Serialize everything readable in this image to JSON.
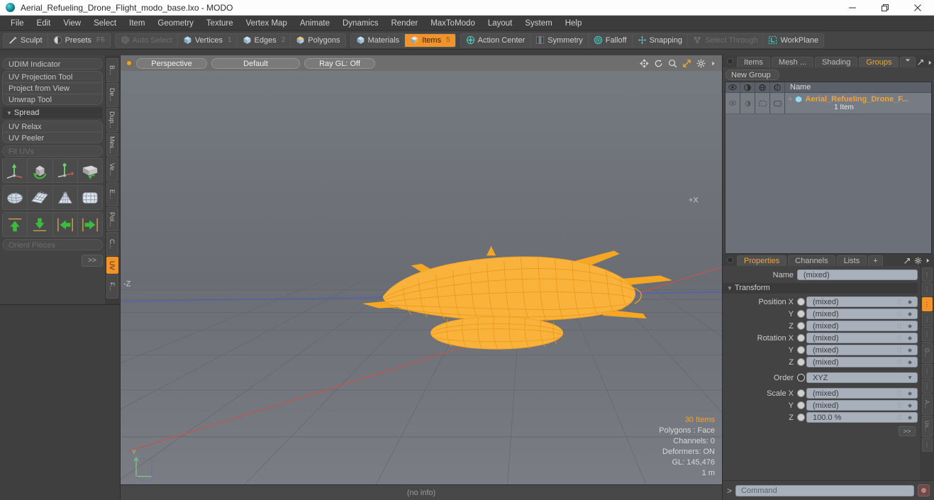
{
  "window": {
    "title": "Aerial_Refueling_Drone_Flight_modo_base.lxo - MODO",
    "app_icon": "modo-sphere-icon",
    "minimize": "minimize-icon",
    "maximize": "restore-icon",
    "close": "close-icon"
  },
  "menubar": {
    "items": [
      {
        "label": "File"
      },
      {
        "label": "Edit"
      },
      {
        "label": "View"
      },
      {
        "label": "Select"
      },
      {
        "label": "Item"
      },
      {
        "label": "Geometry"
      },
      {
        "label": "Texture"
      },
      {
        "label": "Vertex Map"
      },
      {
        "label": "Animate"
      },
      {
        "label": "Dynamics"
      },
      {
        "label": "Render"
      },
      {
        "label": "MaxToModo"
      },
      {
        "label": "Layout"
      },
      {
        "label": "System"
      },
      {
        "label": "Help"
      }
    ]
  },
  "toolbar": {
    "groups": [
      {
        "buttons": [
          {
            "label": "Sculpt",
            "icon": "sculpt-brush-icon",
            "state": "normal",
            "count": ""
          },
          {
            "label": "Presets",
            "icon": "presets-sphere-icon",
            "state": "normal",
            "count": "F6"
          }
        ]
      },
      {
        "buttons": [
          {
            "label": "Auto Select",
            "icon": "auto-select-icon",
            "state": "dim",
            "count": ""
          },
          {
            "label": "Vertices",
            "icon": "vertices-cube-icon",
            "state": "normal",
            "count": "1"
          },
          {
            "label": "Edges",
            "icon": "edges-cube-icon",
            "state": "normal",
            "count": "2"
          },
          {
            "label": "Polygons",
            "icon": "polygons-cube-icon",
            "state": "normal",
            "count": ""
          }
        ]
      },
      {
        "buttons": [
          {
            "label": "Materials",
            "icon": "materials-cube-icon",
            "state": "normal",
            "count": ""
          },
          {
            "label": "Items",
            "icon": "items-cube-icon",
            "state": "active",
            "count": "5"
          }
        ]
      },
      {
        "buttons": [
          {
            "label": "Action Center",
            "icon": "action-center-icon",
            "state": "normal",
            "count": ""
          },
          {
            "label": "Symmetry",
            "icon": "symmetry-icon",
            "state": "normal",
            "count": ""
          },
          {
            "label": "Falloff",
            "icon": "falloff-icon",
            "state": "normal",
            "count": ""
          },
          {
            "label": "Snapping",
            "icon": "snapping-icon",
            "state": "normal",
            "count": ""
          },
          {
            "label": "Select Through",
            "icon": "select-through-icon",
            "state": "dim",
            "count": ""
          },
          {
            "label": "WorkPlane",
            "icon": "workplane-icon",
            "state": "normal",
            "count": ""
          }
        ]
      }
    ]
  },
  "left_panel": {
    "udim_indicator": "UDIM Indicator",
    "projection_group": [
      "UV Projection Tool",
      "Project from View",
      "Unwrap Tool"
    ],
    "spread_header": "Spread",
    "relax_group": [
      "UV Relax",
      "UV Peeler"
    ],
    "fit_uvs": "Fit UVs",
    "orient_pieces": "Orient Pieces",
    "more_button": ">>",
    "icon_rows": [
      [
        "uv-move-gizmo-icon",
        "uv-rotate-cube-icon",
        "uv-transform-gizmo-icon",
        "uv-flip-icon"
      ],
      [
        "uv-sphere-unwrap-icon",
        "uv-plane-grid-icon",
        "uv-cone-unwrap-icon",
        "uv-cylinder-grid-icon"
      ],
      [
        "uv-align-up-icon",
        "uv-align-down-icon",
        "uv-align-left-icon",
        "uv-align-right-icon"
      ]
    ],
    "vtabs": [
      {
        "label": "B...",
        "active": false
      },
      {
        "label": "De...",
        "active": false
      },
      {
        "label": "Dup...",
        "active": false
      },
      {
        "label": "Mes...",
        "active": false
      },
      {
        "label": "Ve...",
        "active": false
      },
      {
        "label": "E...",
        "active": false
      },
      {
        "label": "Pol...",
        "active": false
      },
      {
        "label": "C...",
        "active": false
      },
      {
        "label": "UV",
        "active": true
      },
      {
        "label": "F...",
        "active": false
      }
    ]
  },
  "viewport": {
    "dot": "viewport-active-dot",
    "pills": [
      {
        "label": "Perspective",
        "name": "view-mode-selector"
      },
      {
        "label": "Default",
        "name": "shading-style-selector"
      },
      {
        "label": "Ray GL: Off",
        "name": "raygl-selector"
      }
    ],
    "icons": [
      "pan-icon",
      "rotate-icon",
      "zoom-icon",
      "fit-icon",
      "gear-icon",
      "expand-arrow-icon"
    ],
    "axis_px": "+X",
    "axis_mz": "-Z",
    "gizmo_y": "Y",
    "status": {
      "items": "30 Items",
      "polygons": "Polygons : Face",
      "channels": "Channels: 0",
      "deformers": "Deformers: ON",
      "gl": "GL: 145,476",
      "scale": "1 m"
    },
    "statusbar": "(no info)",
    "model_color": "#f5a623"
  },
  "right_panel": {
    "top_tabs": [
      {
        "label": "Items",
        "active": false
      },
      {
        "label": "Mesh ...",
        "active": false
      },
      {
        "label": "Shading",
        "active": false
      },
      {
        "label": "Groups",
        "active": true
      }
    ],
    "top_tab_caret": "chevron-down-icon",
    "top_expand": "expand-icon",
    "top_more": "more-arrow-icon",
    "new_group_button": "New Group",
    "groups_table": {
      "columns": [
        "visibility-eye-icon",
        "shading-icon",
        "wireframe-icon",
        "lock-icon"
      ],
      "name_header": "Name",
      "rows": [
        {
          "expand": "+",
          "item_icon": "mesh-item-icon",
          "name": "Aerial_Refueling_Drone_F...",
          "sub": "1 Item"
        }
      ]
    },
    "props_tabs": [
      {
        "label": "Properties",
        "active": true
      },
      {
        "label": "Channels",
        "active": false
      },
      {
        "label": "Lists",
        "active": false
      },
      {
        "label": "+",
        "active": false
      }
    ],
    "props_expand": "expand-icon",
    "props_gear": "gear-icon",
    "props_more": "more-arrow-icon",
    "properties": {
      "name_label": "Name",
      "name_value": "(mixed)",
      "transform_section": "Transform",
      "rows": [
        {
          "label": "Position X",
          "value": "(mixed)",
          "zero": "0",
          "kind": "spin"
        },
        {
          "label": "Y",
          "value": "(mixed)",
          "zero": "0",
          "kind": "spin"
        },
        {
          "label": "Z",
          "value": "(mixed)",
          "zero": "0",
          "kind": "spin"
        },
        {
          "label": "Rotation X",
          "value": "(mixed)",
          "zero": "0",
          "kind": "spin"
        },
        {
          "label": "Y",
          "value": "(mixed)",
          "zero": "0",
          "kind": "spin"
        },
        {
          "label": "Z",
          "value": "(mixed)",
          "zero": "0",
          "kind": "spin"
        },
        {
          "label": "Order",
          "value": "XYZ",
          "zero": "",
          "kind": "dropdown"
        },
        {
          "label": "Scale X",
          "value": "(mixed)",
          "zero": "0",
          "kind": "spin"
        },
        {
          "label": "Y",
          "value": "(mixed)",
          "zero": "0",
          "kind": "spin"
        },
        {
          "label": "Z",
          "value": "100.0 %",
          "zero": "0",
          "kind": "spin"
        }
      ],
      "more_button": ">>"
    },
    "side_strip": [
      {
        "label": "",
        "active": false
      },
      {
        "label": "",
        "active": false
      },
      {
        "label": "",
        "active": true
      },
      {
        "label": "",
        "active": false
      },
      {
        "label": "",
        "active": false
      },
      {
        "label": "G...",
        "active": false
      },
      {
        "label": "",
        "active": false
      },
      {
        "label": "",
        "active": false
      },
      {
        "label": "A...",
        "active": false
      },
      {
        "label": "Us...",
        "active": false
      },
      {
        "label": "",
        "active": false
      }
    ],
    "command": {
      "prompt": ">",
      "placeholder": "Command",
      "record_icon": "record-icon"
    }
  }
}
